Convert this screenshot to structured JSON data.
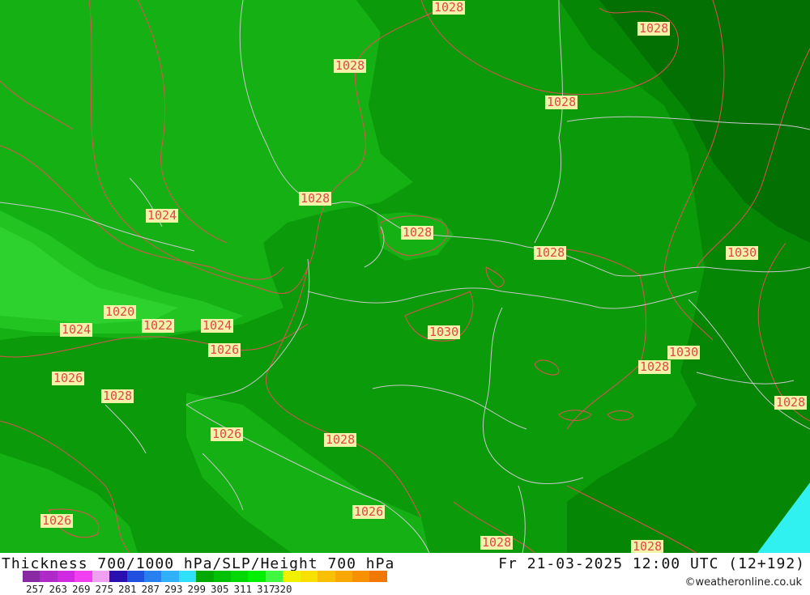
{
  "map": {
    "isobar_labels": [
      "1028",
      "1028",
      "1028",
      "1028",
      "1028",
      "1024",
      "1028",
      "1028",
      "1030",
      "1020",
      "1024",
      "1022",
      "1024",
      "1030",
      "1026",
      "1030",
      "1028",
      "1026",
      "1028",
      "1028",
      "1026",
      "1028",
      "1026",
      "1026",
      "1028",
      "1028"
    ]
  },
  "footer": {
    "title": "Thickness 700/1000 hPa/SLP/Height 700 hPa",
    "datetime": "Fr 21-03-2025 12:00 UTC (12+192)",
    "credit": "©weatheronline.co.uk",
    "scale_ticks": [
      "257",
      "263",
      "269",
      "275",
      "281",
      "287",
      "293",
      "299",
      "305",
      "311",
      "317",
      "320"
    ],
    "scale_colors": [
      "#8a2aa2",
      "#b02ac8",
      "#d02ae0",
      "#f040f0",
      "#f0a0f0",
      "#2a10b0",
      "#2050e0",
      "#2880f0",
      "#30b0f8",
      "#30e0f8",
      "#00a800",
      "#00c000",
      "#00d800",
      "#00f000",
      "#40f840",
      "#f0f000",
      "#f8e000",
      "#f8c000",
      "#f8a800",
      "#f89000",
      "#f07800"
    ]
  }
}
